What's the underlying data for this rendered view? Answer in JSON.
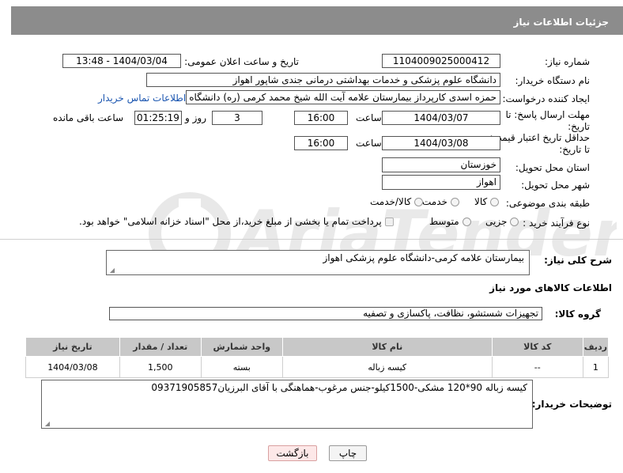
{
  "header": {
    "title": "جزئیات اطلاعات نیاز"
  },
  "fields": {
    "need_number_label": "شماره نیاز:",
    "need_number_value": "1104009025000412",
    "announce_label": "تاریخ و ساعت اعلان عمومی:",
    "announce_value": "1404/03/04 - 13:48",
    "buyer_org_label": "نام دستگاه خریدار:",
    "buyer_org_value": "دانشگاه علوم پزشکی و خدمات بهداشتی درمانی جندی شاپور اهواز",
    "requester_label": "ایجاد کننده درخواست:",
    "requester_value": "حمزه اسدی کارپرداز بیمارستان علامه آیت الله شیخ محمد کرمی (ره) دانشگاه ع",
    "contact_link": "اطلاعات تماس خریدار",
    "deadline_label_1": "مهلت ارسال پاسخ: تا",
    "deadline_label_2": "تاریخ:",
    "deadline_date": "1404/03/07",
    "time_label": "ساعت",
    "deadline_time": "16:00",
    "days_value": "3",
    "days_label": "روز و",
    "remaining_value": "01:25:19",
    "remaining_label": "ساعت باقی مانده",
    "validity_label_1": "حداقل تاریخ اعتبار قیمت:",
    "validity_label_2": "تا تاریخ:",
    "validity_date": "1404/03/08",
    "validity_time": "16:00",
    "province_label": "استان محل تحویل:",
    "province_value": "خوزستان",
    "city_label": "شهر محل تحویل:",
    "city_value": "اهواز",
    "category_label": "طبقه بندی موضوعی:",
    "category_options": [
      "کالا",
      "خدمت",
      "کالا/خدمت"
    ],
    "process_label": "نوع فرآیند خرید :",
    "process_options": [
      "جزیی",
      "متوسط"
    ],
    "payment_note": "پرداخت تمام یا بخشی از مبلغ خرید،از محل \"اسناد خزانه اسلامی\" خواهد بود."
  },
  "description": {
    "label": "شرح کلی نیاز:",
    "value": "بیمارستان علامه کرمی-دانشگاه علوم پزشکی اهواز"
  },
  "goods_section": {
    "title": "اطلاعات کالاهای مورد نیاز",
    "group_label": "گروه کالا:",
    "group_value": "تجهیزات شستشو، نظافت، پاکسازی و تصفیه"
  },
  "table": {
    "headers": [
      "ردیف",
      "کد کالا",
      "نام کالا",
      "واحد شمارش",
      "تعداد / مقدار",
      "تاریخ نیاز"
    ],
    "rows": [
      [
        "1",
        "--",
        "کیسه زباله",
        "بسته",
        "1,500",
        "1404/03/08"
      ]
    ]
  },
  "buyer_notes": {
    "label": "توضیحات خریدار:",
    "value": "کیسه زباله 90*120 مشکی-1500کیلو-جنس مرغوب-هماهنگی با آقای البرزیان09371905857"
  },
  "buttons": {
    "print": "چاپ",
    "back": "بازگشت"
  },
  "watermark": {
    "text": "AriaTender.net",
    "color": "#e6e6e6"
  },
  "colors": {
    "header_bg": "#8c8c8c",
    "link": "#1a55b0",
    "back_button_bg": "#fde8e8"
  }
}
